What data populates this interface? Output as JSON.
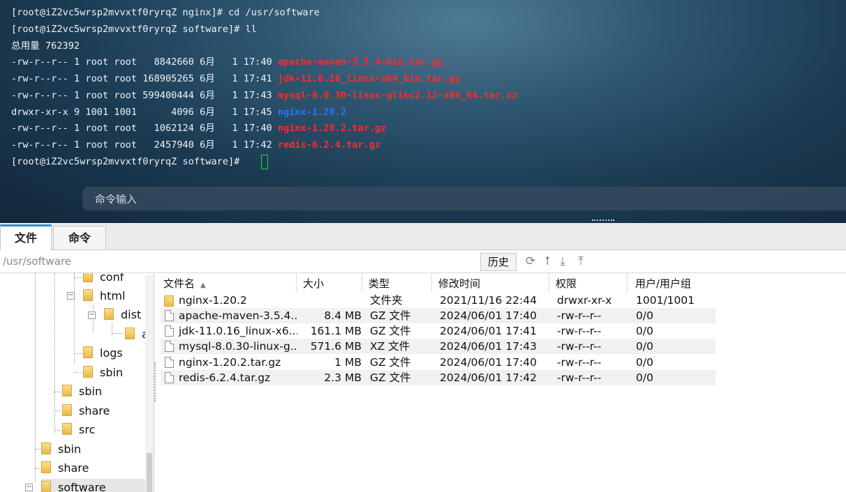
{
  "terminal": {
    "lines": [
      {
        "text": "[root@iZ2vc5wrsp2mvvxtf0ryrqZ nginx]# cd /usr/software",
        "file": "",
        "color": ""
      },
      {
        "text": "[root@iZ2vc5wrsp2mvvxtf0ryrqZ software]# ll",
        "file": "",
        "color": ""
      },
      {
        "text": "总用量 762392",
        "file": "",
        "color": ""
      },
      {
        "text": "-rw-r--r-- 1 root root   8842660 6月   1 17:40 ",
        "file": "apache-maven-3.5.4-bin.tar.gz",
        "color": "#ff2a2a"
      },
      {
        "text": "-rw-r--r-- 1 root root 168905265 6月   1 17:41 ",
        "file": "jdk-11.0.16_linux-x64_bin.tar.gz",
        "color": "#ff2a2a"
      },
      {
        "text": "-rw-r--r-- 1 root root 599400444 6月   1 17:43 ",
        "file": "mysql-8.0.30-linux-glibc2.12-x86_64.tar.xz",
        "color": "#ff2a2a"
      },
      {
        "text": "drwxr-xr-x 9 1001 1001      4096 6月   1 17:45 ",
        "file": "nginx-1.20.2",
        "color": "#2f6fff"
      },
      {
        "text": "-rw-r--r-- 1 root root   1062124 6月   1 17:40 ",
        "file": "nginx-1.20.2.tar.gz",
        "color": "#ff2a2a"
      },
      {
        "text": "-rw-r--r-- 1 root root   2457940 6月   1 17:42 ",
        "file": "redis-6.2.4.tar.gz",
        "color": "#ff2a2a"
      },
      {
        "text": "[root@iZ2vc5wrsp2mvvxtf0ryrqZ software]# ",
        "file": "",
        "color": ""
      }
    ],
    "command_placeholder": "命令输入"
  },
  "tabs": [
    {
      "label": "文件"
    },
    {
      "label": "命令"
    }
  ],
  "pathbar": {
    "path": "/usr/software",
    "history_label": "历史",
    "icons": [
      "refresh-icon",
      "up-arrow-icon",
      "download-icon",
      "upload-icon"
    ]
  },
  "tree": {
    "nodes": [
      {
        "label": "conf",
        "expander": ""
      },
      {
        "label": "html",
        "expander": "minus"
      },
      {
        "label": "dist",
        "expander": "minus"
      },
      {
        "label": "a",
        "expander": ""
      },
      {
        "label": "logs",
        "expander": ""
      },
      {
        "label": "sbin",
        "expander": ""
      },
      {
        "label": "sbin",
        "expander": ""
      },
      {
        "label": "share",
        "expander": ""
      },
      {
        "label": "src",
        "expander": ""
      },
      {
        "label": "sbin",
        "expander": ""
      },
      {
        "label": "share",
        "expander": ""
      },
      {
        "label": "software",
        "expander": "minus"
      }
    ]
  },
  "filelist": {
    "columns": [
      "文件名",
      "大小",
      "类型",
      "修改时间",
      "权限",
      "用户/用户组"
    ],
    "rows": [
      {
        "name": "nginx-1.20.2",
        "size": "",
        "type": "文件夹",
        "modified": "2021/11/16 22:44",
        "perm": "drwxr-xr-x",
        "owner": "1001/1001",
        "is_dir": true
      },
      {
        "name": "apache-maven-3.5.4...",
        "size": "8.4 MB",
        "type": "GZ 文件",
        "modified": "2024/06/01 17:40",
        "perm": "-rw-r--r--",
        "owner": "0/0",
        "is_dir": false
      },
      {
        "name": "jdk-11.0.16_linux-x6...",
        "size": "161.1 MB",
        "type": "GZ 文件",
        "modified": "2024/06/01 17:41",
        "perm": "-rw-r--r--",
        "owner": "0/0",
        "is_dir": false
      },
      {
        "name": "mysql-8.0.30-linux-g...",
        "size": "571.6 MB",
        "type": "XZ 文件",
        "modified": "2024/06/01 17:43",
        "perm": "-rw-r--r--",
        "owner": "0/0",
        "is_dir": false
      },
      {
        "name": "nginx-1.20.2.tar.gz",
        "size": "1 MB",
        "type": "GZ 文件",
        "modified": "2024/06/01 17:40",
        "perm": "-rw-r--r--",
        "owner": "0/0",
        "is_dir": false
      },
      {
        "name": "redis-6.2.4.tar.gz",
        "size": "2.3 MB",
        "type": "GZ 文件",
        "modified": "2024/06/01 17:42",
        "perm": "-rw-r--r--",
        "owner": "0/0",
        "is_dir": false
      }
    ]
  }
}
